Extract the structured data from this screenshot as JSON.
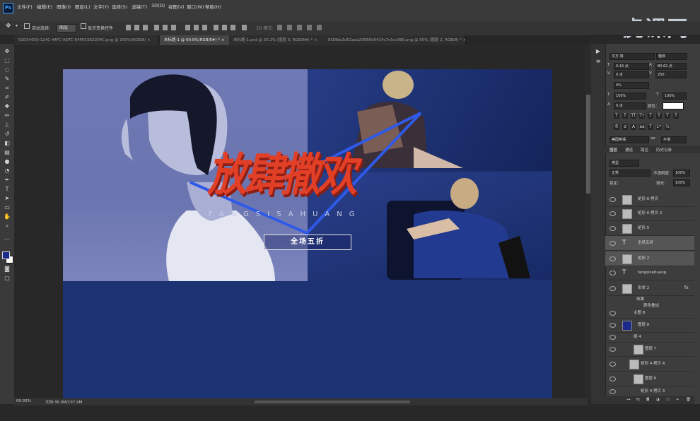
{
  "app": {
    "logo": "Ps"
  },
  "menu": [
    "文件(F)",
    "编辑(E)",
    "图像(I)",
    "图层(L)",
    "文字(Y)",
    "选择(S)",
    "滤镜(T)",
    "3D(D)",
    "视图(V)",
    "窗口(W)",
    "帮助(H)"
  ],
  "options": {
    "auto_select_label": "自动选择：",
    "auto_select_value": "图层",
    "show_transform": "显示变换控件"
  },
  "tabs": [
    {
      "label": "91D54650-124C-44FC-ADTC-64FEC062204C.png @ 100%(RGB/8) ×",
      "active": false
    },
    {
      "label": "未标题-1 @ 69.9%(RGB/8#) * ×",
      "active": true
    },
    {
      "label": "未标题-1.psd @ 33.2% (图层 3, RGB/8#) * ×",
      "active": false
    },
    {
      "label": "8f28bb3d52aaa29580d6414c7c5cc389.png @ 50% (图层 2, RGB/8) * ×",
      "active": false
    }
  ],
  "status": {
    "zoom": "69.93%",
    "doc": "文档:36.0M/107.9M"
  },
  "artboard": {
    "title": "放肆撒欢",
    "subtitle": "FANGSISAHUANG",
    "promo": "全场五折"
  },
  "character_panel": {
    "font_family": "平方 简",
    "font_style": "粗体",
    "font_size": "9.16 点",
    "leading": "80.62 点",
    "kerning": "0 点",
    "tracking": "250",
    "baseline_pct": "0%",
    "vscale": "100%",
    "hscale": "100%",
    "shift": "0 点",
    "color_label": "颜色：",
    "language": "美国英语",
    "aa": "平滑"
  },
  "layers_panel": {
    "tabs": [
      "图层",
      "通道",
      "路径",
      "历史记录"
    ],
    "filter": "类型",
    "blend": "正常",
    "opacity_label": "不透明度：",
    "opacity": "100%",
    "lock_label": "锁定：",
    "fill_label": "填充：",
    "fill": "100%",
    "layers": [
      {
        "name": "矩形 6 拷贝",
        "kind": "shape",
        "selected": false
      },
      {
        "name": "矩形 6 拷贝 2",
        "kind": "shape",
        "selected": false
      },
      {
        "name": "矩形 5",
        "kind": "shape",
        "selected": false
      },
      {
        "name": "全场五折",
        "kind": "text",
        "selected": true
      },
      {
        "name": "矩形 2",
        "kind": "shape",
        "selected": true
      },
      {
        "name": "fangsisahuang",
        "kind": "text",
        "selected": false
      },
      {
        "name": "形状 2",
        "kind": "shape",
        "selected": false
      },
      {
        "name": "效果",
        "kind": "fx",
        "selected": false
      },
      {
        "name": "颜色叠加",
        "kind": "fx",
        "selected": false
      },
      {
        "name": "主图 8",
        "kind": "group",
        "selected": false
      },
      {
        "name": "图层 8",
        "kind": "pixel",
        "selected": false
      },
      {
        "name": "组 4",
        "kind": "group",
        "selected": false
      },
      {
        "name": "图层 7",
        "kind": "pixel",
        "selected": false
      },
      {
        "name": "矩形 4 拷贝 4",
        "kind": "shape",
        "selected": false
      },
      {
        "name": "图层 6",
        "kind": "pixel",
        "selected": false
      },
      {
        "name": "矩形 4 拷贝 3",
        "kind": "shape",
        "selected": false
      }
    ]
  },
  "watermark": "虎课网",
  "colors": {
    "accent": "#e23f27",
    "artboard_bg": "#1c3272",
    "foreground_swatch": "#1a2a8a",
    "background_swatch": "#ffffff"
  }
}
